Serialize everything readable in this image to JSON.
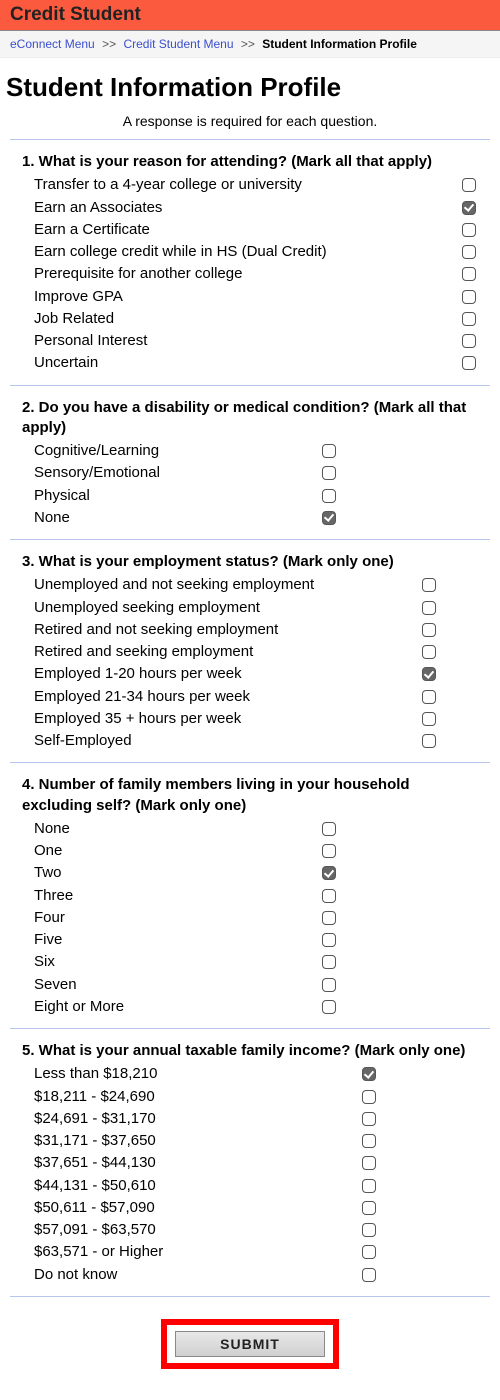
{
  "header": {
    "title": "Credit Student"
  },
  "breadcrumb": {
    "items": [
      {
        "label": "eConnect Menu",
        "link": true
      },
      {
        "label": "Credit Student Menu",
        "link": true
      },
      {
        "label": "Student Information Profile",
        "link": false
      }
    ],
    "separator": ">>"
  },
  "page_title": "Student Information Profile",
  "instruction": "A response is required for each question.",
  "questions": [
    {
      "id": "q1",
      "title": "1. What is your reason for attending? (Mark all that apply)",
      "options": [
        {
          "label": "Transfer to a 4-year college or university",
          "checked": false
        },
        {
          "label": "Earn an Associates",
          "checked": true
        },
        {
          "label": "Earn a Certificate",
          "checked": false
        },
        {
          "label": "Earn college credit while in HS (Dual Credit)",
          "checked": false
        },
        {
          "label": "Prerequisite for another college",
          "checked": false
        },
        {
          "label": "Improve GPA",
          "checked": false
        },
        {
          "label": "Job Related",
          "checked": false
        },
        {
          "label": "Personal Interest",
          "checked": false
        },
        {
          "label": "Uncertain",
          "checked": false
        }
      ]
    },
    {
      "id": "q2",
      "title": "2. Do you have a disability or medical condition? (Mark all that apply)",
      "options": [
        {
          "label": "Cognitive/Learning",
          "checked": false
        },
        {
          "label": "Sensory/Emotional",
          "checked": false
        },
        {
          "label": "Physical",
          "checked": false
        },
        {
          "label": "None",
          "checked": true
        }
      ]
    },
    {
      "id": "q3",
      "title": "3. What is your employment status? (Mark only one)",
      "options": [
        {
          "label": "Unemployed and not seeking employment",
          "checked": false
        },
        {
          "label": "Unemployed seeking employment",
          "checked": false
        },
        {
          "label": "Retired and not seeking employment",
          "checked": false
        },
        {
          "label": "Retired and seeking employment",
          "checked": false
        },
        {
          "label": "Employed 1-20 hours per week",
          "checked": true
        },
        {
          "label": "Employed 21-34 hours per week",
          "checked": false
        },
        {
          "label": "Employed 35 + hours per week",
          "checked": false
        },
        {
          "label": "Self-Employed",
          "checked": false
        }
      ]
    },
    {
      "id": "q4",
      "title": "4. Number of family members living in your household excluding self? (Mark only one)",
      "options": [
        {
          "label": "None",
          "checked": false
        },
        {
          "label": "One",
          "checked": false
        },
        {
          "label": "Two",
          "checked": true
        },
        {
          "label": "Three",
          "checked": false
        },
        {
          "label": "Four",
          "checked": false
        },
        {
          "label": "Five",
          "checked": false
        },
        {
          "label": "Six",
          "checked": false
        },
        {
          "label": "Seven",
          "checked": false
        },
        {
          "label": "Eight or More",
          "checked": false
        }
      ]
    },
    {
      "id": "q5",
      "title": "5. What is your annual taxable family income? (Mark only one)",
      "options": [
        {
          "label": "Less than $18,210",
          "checked": true
        },
        {
          "label": "$18,211 - $24,690",
          "checked": false
        },
        {
          "label": "$24,691 - $31,170",
          "checked": false
        },
        {
          "label": "$31,171 - $37,650",
          "checked": false
        },
        {
          "label": "$37,651 - $44,130",
          "checked": false
        },
        {
          "label": "$44,131 - $50,610",
          "checked": false
        },
        {
          "label": "$50,611 - $57,090",
          "checked": false
        },
        {
          "label": "$57,091 - $63,570",
          "checked": false
        },
        {
          "label": "$63,571 - or Higher",
          "checked": false
        },
        {
          "label": "Do not know",
          "checked": false
        }
      ]
    }
  ],
  "submit": {
    "label": "SUBMIT"
  }
}
